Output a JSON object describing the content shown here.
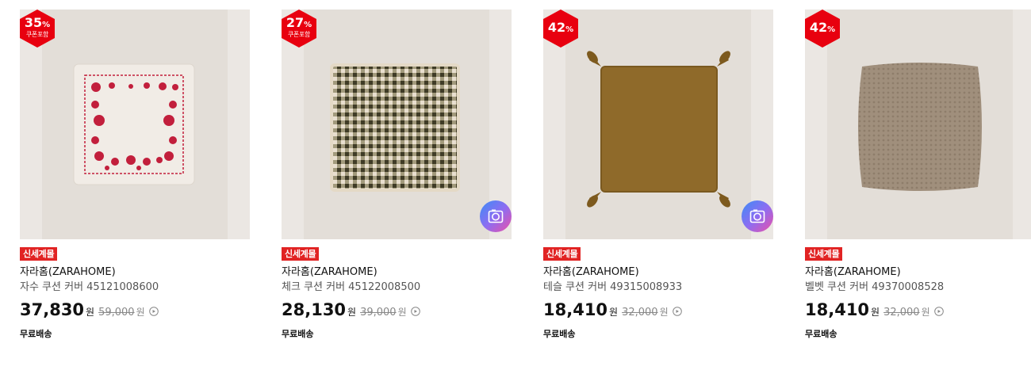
{
  "products": [
    {
      "discount": "35",
      "discount_unit": "%",
      "coupon_label": "쿠폰포함",
      "tag": "신세계몰",
      "brand": "자라홈(ZARAHOME)",
      "name": "자수 쿠션 커버 45121008600",
      "price": "37,830",
      "price_unit": "원",
      "original_price": "59,000",
      "original_unit": "원",
      "shipping": "무료배송",
      "has_camera": false,
      "image": "embroidered-cushion"
    },
    {
      "discount": "27",
      "discount_unit": "%",
      "coupon_label": "쿠폰포함",
      "tag": "신세계몰",
      "brand": "자라홈(ZARAHOME)",
      "name": "체크 쿠션 커버 45122008500",
      "price": "28,130",
      "price_unit": "원",
      "original_price": "39,000",
      "original_unit": "원",
      "shipping": "무료배송",
      "has_camera": true,
      "image": "gingham-cushion"
    },
    {
      "discount": "42",
      "discount_unit": "%",
      "coupon_label": "",
      "tag": "신세계몰",
      "brand": "자라홈(ZARAHOME)",
      "name": "테슬 쿠션 커버 49315008933",
      "price": "18,410",
      "price_unit": "원",
      "original_price": "32,000",
      "original_unit": "원",
      "shipping": "무료배송",
      "has_camera": true,
      "image": "tassel-cushion"
    },
    {
      "discount": "42",
      "discount_unit": "%",
      "coupon_label": "",
      "tag": "신세계몰",
      "brand": "자라홈(ZARAHOME)",
      "name": "벨벳 쿠션 커버 49370008528",
      "price": "18,410",
      "price_unit": "원",
      "original_price": "32,000",
      "original_unit": "원",
      "shipping": "무료배송",
      "has_camera": false,
      "image": "velvet-cushion"
    }
  ],
  "colors": {
    "badge": "#e8000f",
    "tag": "#e12323",
    "embroidery": "#c21f3c",
    "gingham_dark": "#4f4a32",
    "tassel_mustard": "#8f6a2a",
    "velvet_taupe": "#a08f7c"
  },
  "icons": {
    "camera": "camera-icon",
    "info": "info-circle-icon"
  }
}
